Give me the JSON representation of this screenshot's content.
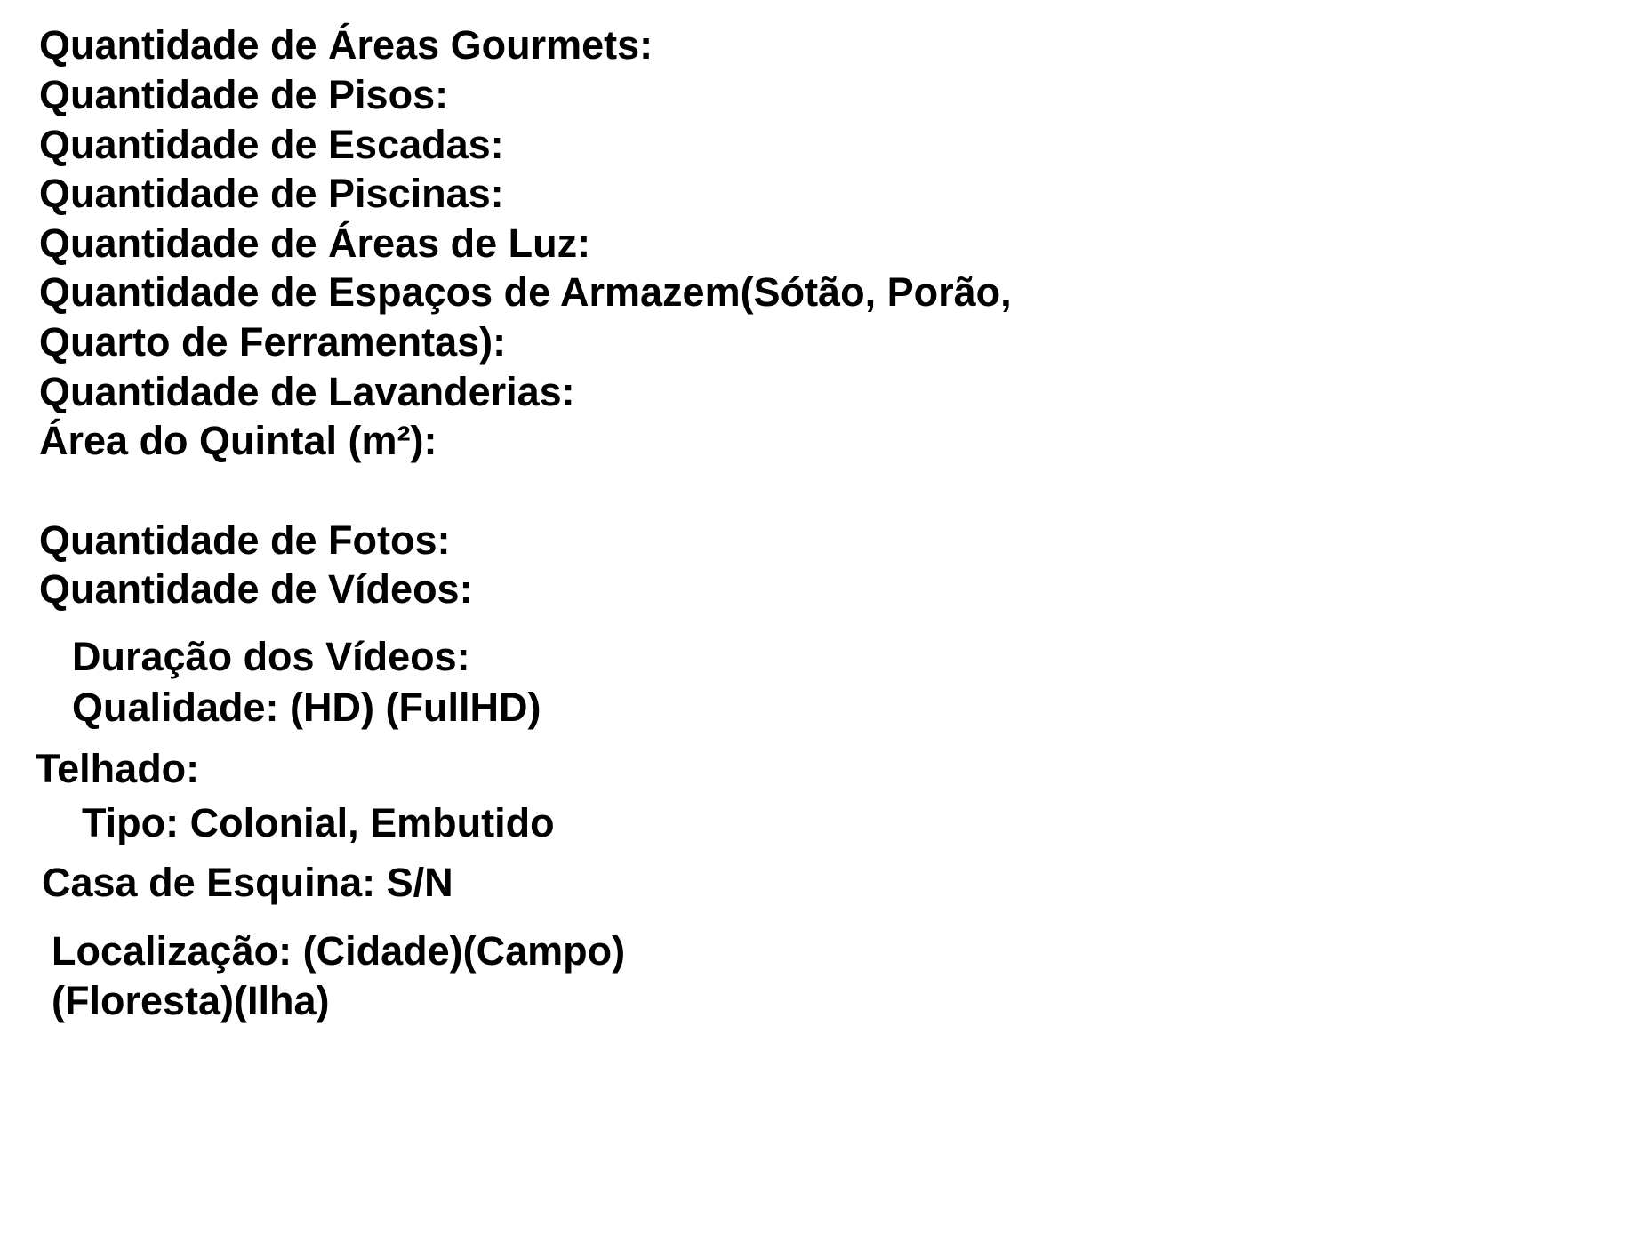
{
  "document": {
    "lines": [
      "Quantidade de Áreas Gourmets:",
      "Quantidade de Pisos:",
      "Quantidade de Escadas:",
      "Quantidade de Piscinas:",
      "Quantidade de Áreas de Luz:",
      "Quantidade de Espaços de Armazem(Sótão, Porão,",
      "Quarto de Ferramentas):",
      "Quantidade de Lavanderias:",
      "Área do Quintal (m²):",
      "Quantidade de Fotos:",
      "Quantidade de Vídeos:",
      "Duração dos Vídeos:",
      "Qualidade: (HD) (FullHD)",
      "Telhado:",
      "Tipo: Colonial, Embutido",
      "Casa de Esquina: S/N",
      "Localização: (Cidade)(Campo)",
      "(Floresta)(Ilha)"
    ]
  }
}
